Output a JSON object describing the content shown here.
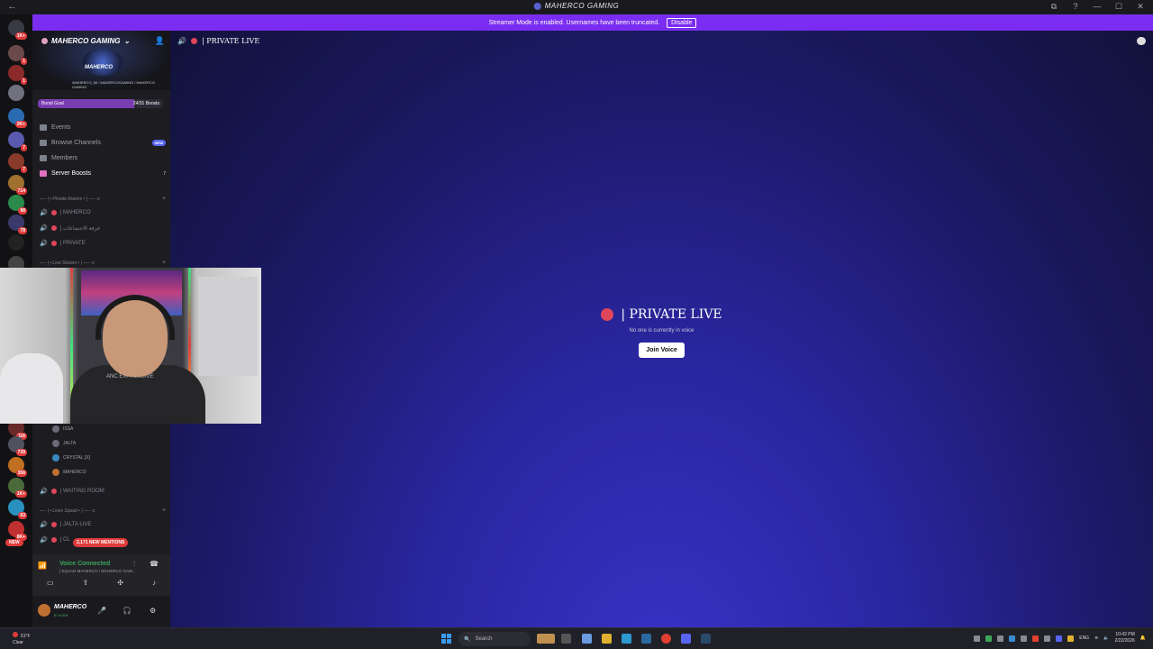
{
  "window": {
    "title": "MAHERCO GAMING",
    "controls": [
      "⧉",
      "?",
      "—",
      "☐",
      "✕"
    ]
  },
  "banner": {
    "message": "Streamer Mode is enabled. Usernames have been truncated.",
    "disable_label": "Disable"
  },
  "rail": {
    "badges": [
      "1K+",
      "1",
      "1",
      "2K+",
      "7",
      "7",
      "714",
      "98",
      "78",
      "116",
      "739",
      "356",
      "1K+",
      "63",
      "8K+"
    ],
    "new_label": "NEW"
  },
  "server": {
    "name": "MAHERCO GAMING",
    "logo_text": "MAHERCO",
    "logo_sub": "/MAHERCO_MI / MAHERCOGAMING / MAHERCO GAMING",
    "boost_label": "Boost Goal",
    "boost_count": "24/31 Boosts",
    "boost_progress": 0.77
  },
  "nav": [
    {
      "label": "Events"
    },
    {
      "label": "Browse Channels",
      "tag": "NEW"
    },
    {
      "label": "Members"
    },
    {
      "label": "Server Boosts",
      "count": "7"
    }
  ],
  "categories": {
    "private_rooms": "── | • Private Rooms • | ── -c",
    "live_stream": "── | • Live Stream • | ── -c",
    "lives_squad": "── | • Lives Squad • | ── -c"
  },
  "channels": {
    "maherco": "| MAHERCO",
    "meetings": "| غرفة الاجتماعات",
    "private": "| PRIVATE",
    "waiting": "| WAITING ROOM",
    "jalta_live": "| JALTA LIVE",
    "cl": "| CL"
  },
  "members": [
    "ISSA",
    "JALTA",
    "CRYSTAL [X]",
    "MAHERCO"
  ],
  "mentions": "2,171 NEW MENTIONS",
  "voice": {
    "title": "Voice Connected",
    "subtitle": "| SQUAD MAHERCO / MAHERCO GAM..."
  },
  "user": {
    "name": "MAHERCO",
    "status": "In voice"
  },
  "main": {
    "channel_title": "| PRIVATE LIVE",
    "center_title": "| PRIVATE LIVE",
    "empty_text": "No one is currently in voice",
    "join_label": "Join Voice"
  },
  "webcam": {
    "shirt_text": "ANC EXPRESSIVE"
  },
  "taskbar": {
    "weather_temp": "51°F",
    "weather_desc": "Clear",
    "search_placeholder": "Search",
    "lang": "ENG",
    "time": "10:42 PM",
    "date": "2/22/2026"
  },
  "colors": {
    "banner": "#7a2df0",
    "accent": "#5865f2",
    "mention": "#e03b3b",
    "voice_green": "#3ba55c"
  }
}
